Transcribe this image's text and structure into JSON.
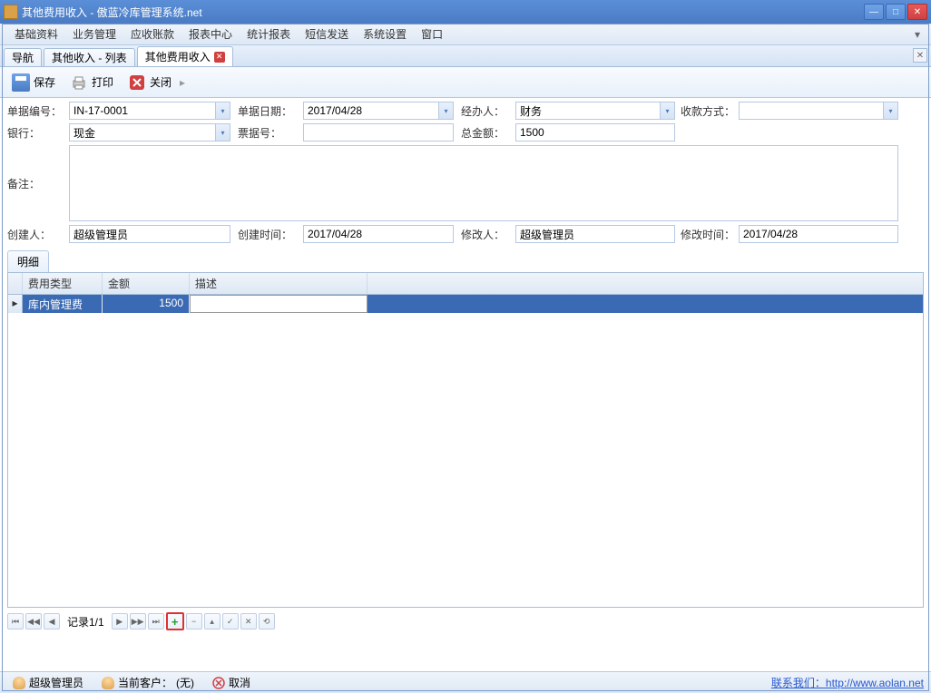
{
  "window": {
    "title": "其他费用收入 - 傲蓝冷库管理系统.net"
  },
  "menu": [
    "基础资料",
    "业务管理",
    "应收账款",
    "报表中心",
    "统计报表",
    "短信发送",
    "系统设置",
    "窗口"
  ],
  "tabs": [
    {
      "label": "导航",
      "closable": false
    },
    {
      "label": "其他收入 - 列表",
      "closable": false
    },
    {
      "label": "其他费用收入",
      "closable": true,
      "active": true
    }
  ],
  "toolbar": {
    "save": "保存",
    "print": "打印",
    "close": "关闭"
  },
  "form": {
    "labels": {
      "docNo": "单据编号：",
      "docDate": "单据日期：",
      "handler": "经办人：",
      "payMethod": "收款方式：",
      "bank": "银行：",
      "billNo": "票据号：",
      "total": "总金额：",
      "remark": "备注：",
      "creator": "创建人：",
      "createTime": "创建时间：",
      "modifier": "修改人：",
      "modifyTime": "修改时间："
    },
    "values": {
      "docNo": "IN-17-0001",
      "docDate": "2017/04/28",
      "handler": "财务",
      "payMethod": "",
      "bank": "现金",
      "billNo": "",
      "total": "1500",
      "remark": "",
      "creator": "超级管理员",
      "createTime": "2017/04/28",
      "modifier": "超级管理员",
      "modifyTime": "2017/04/28"
    }
  },
  "detailTab": "明细",
  "grid": {
    "headers": {
      "type": "费用类型",
      "amount": "金额",
      "desc": "描述"
    },
    "rows": [
      {
        "type": "库内管理费",
        "amount": "1500",
        "desc": ""
      }
    ]
  },
  "recordNav": {
    "text": "记录1/1"
  },
  "status": {
    "user": "超级管理员",
    "clientLabel": "当前客户：",
    "clientValue": "(无)",
    "cancel": "取消",
    "contactLabel": "联系我们：",
    "contactUrl": "http://www.aolan.net"
  }
}
